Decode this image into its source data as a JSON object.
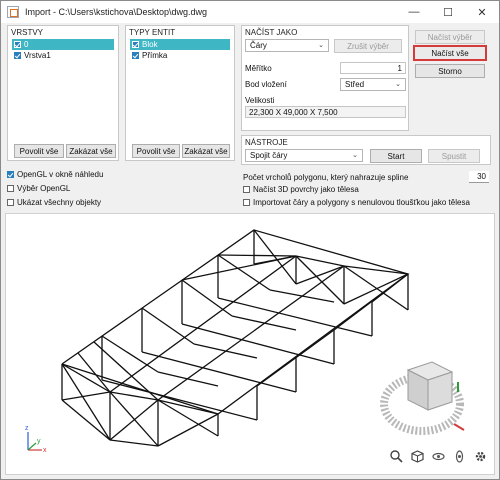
{
  "window": {
    "title": "Import - C:\\Users\\kstichova\\Desktop\\dwg.dwg",
    "minimize_glyph": "—",
    "maximize_glyph": "☐",
    "close_glyph": "✕"
  },
  "layers": {
    "header": "VRSTVY",
    "items": [
      {
        "label": "0",
        "checked": true,
        "selected": true
      },
      {
        "label": "Vrstva1",
        "checked": true,
        "selected": false
      }
    ],
    "enable_all": "Povolit vše",
    "disable_all": "Zakázat vše"
  },
  "entities": {
    "header": "TYPY ENTIT",
    "items": [
      {
        "label": "Blok",
        "checked": true,
        "selected": true
      },
      {
        "label": "Přímka",
        "checked": true,
        "selected": false
      }
    ],
    "enable_all": "Povolit vše",
    "disable_all": "Zakázat vše"
  },
  "load_as": {
    "header": "NAČÍST JAKO",
    "type_value": "Čáry",
    "reset_selection": "Zrušit výběr",
    "scale_label": "Měřítko",
    "scale_value": "1",
    "insert_point_label": "Bod vložení",
    "insert_point_value": "Střed",
    "sizes_label": "Velikosti",
    "sizes_value": "22,300 X 49,000 X 7,500"
  },
  "tools": {
    "header": "NÁSTROJE",
    "tool_value": "Spojit čáry",
    "start": "Start",
    "run": "Spustit"
  },
  "actions": {
    "load_selection": "Načíst výběr",
    "load_all": "Načíst vše",
    "cancel": "Storno"
  },
  "options": {
    "opengl_preview": {
      "label": "OpenGL v okně náhledu",
      "checked": true
    },
    "opengl_select": {
      "label": "Výběr OpenGL",
      "checked": false
    },
    "show_all": {
      "label": "Ukázat všechny objekty",
      "checked": false
    },
    "polygon_vertices_label": "Počet vrcholů polygonu, který nahrazuje spline",
    "polygon_vertices_value": "30",
    "load_3d": {
      "label": "Načíst 3D povrchy jako tělesa",
      "checked": false
    },
    "import_zero": {
      "label": "Importovat čáry a polygony s nenulovou tloušťkou jako tělesa",
      "checked": false
    }
  },
  "viewport": {
    "axis_x": "x",
    "axis_y": "y",
    "axis_z": "z",
    "icons": [
      "zoom-icon",
      "cube-view-icon",
      "orbit-icon",
      "pan-icon",
      "settings-icon"
    ]
  },
  "colors": {
    "selection": "#3fb6c4",
    "checkbox": "#2a7fbf",
    "highlight": "#d43a3a"
  }
}
